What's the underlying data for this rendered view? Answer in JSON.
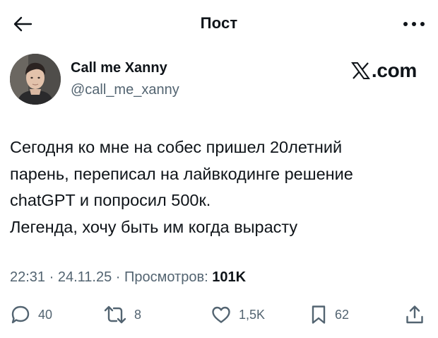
{
  "header": {
    "title": "Пост",
    "back_icon": "arrow-left-icon",
    "more_icon": "more-horizontal-icon"
  },
  "author": {
    "display_name": "Call me Xanny",
    "handle": "@call_me_xanny"
  },
  "source": {
    "label": ".com",
    "icon": "x-logo-icon"
  },
  "tweet": {
    "lines": [
      "Сегодня ко мне на собес пришел 20летний",
      "парень, переписал на лайвкодинге решение",
      "chatGPT и попросил 500к.",
      "Легенда, хочу быть им когда вырасту"
    ]
  },
  "meta": {
    "time": "22:31",
    "separator": " · ",
    "date": "24.11.25",
    "views_label": "Просмотров:",
    "views_count": "101K"
  },
  "actions": {
    "replies": "40",
    "reposts": "8",
    "likes": "1,5K",
    "bookmarks": "62"
  },
  "colors": {
    "text_primary": "#0f1419",
    "text_secondary": "#536471",
    "background": "#ffffff"
  }
}
